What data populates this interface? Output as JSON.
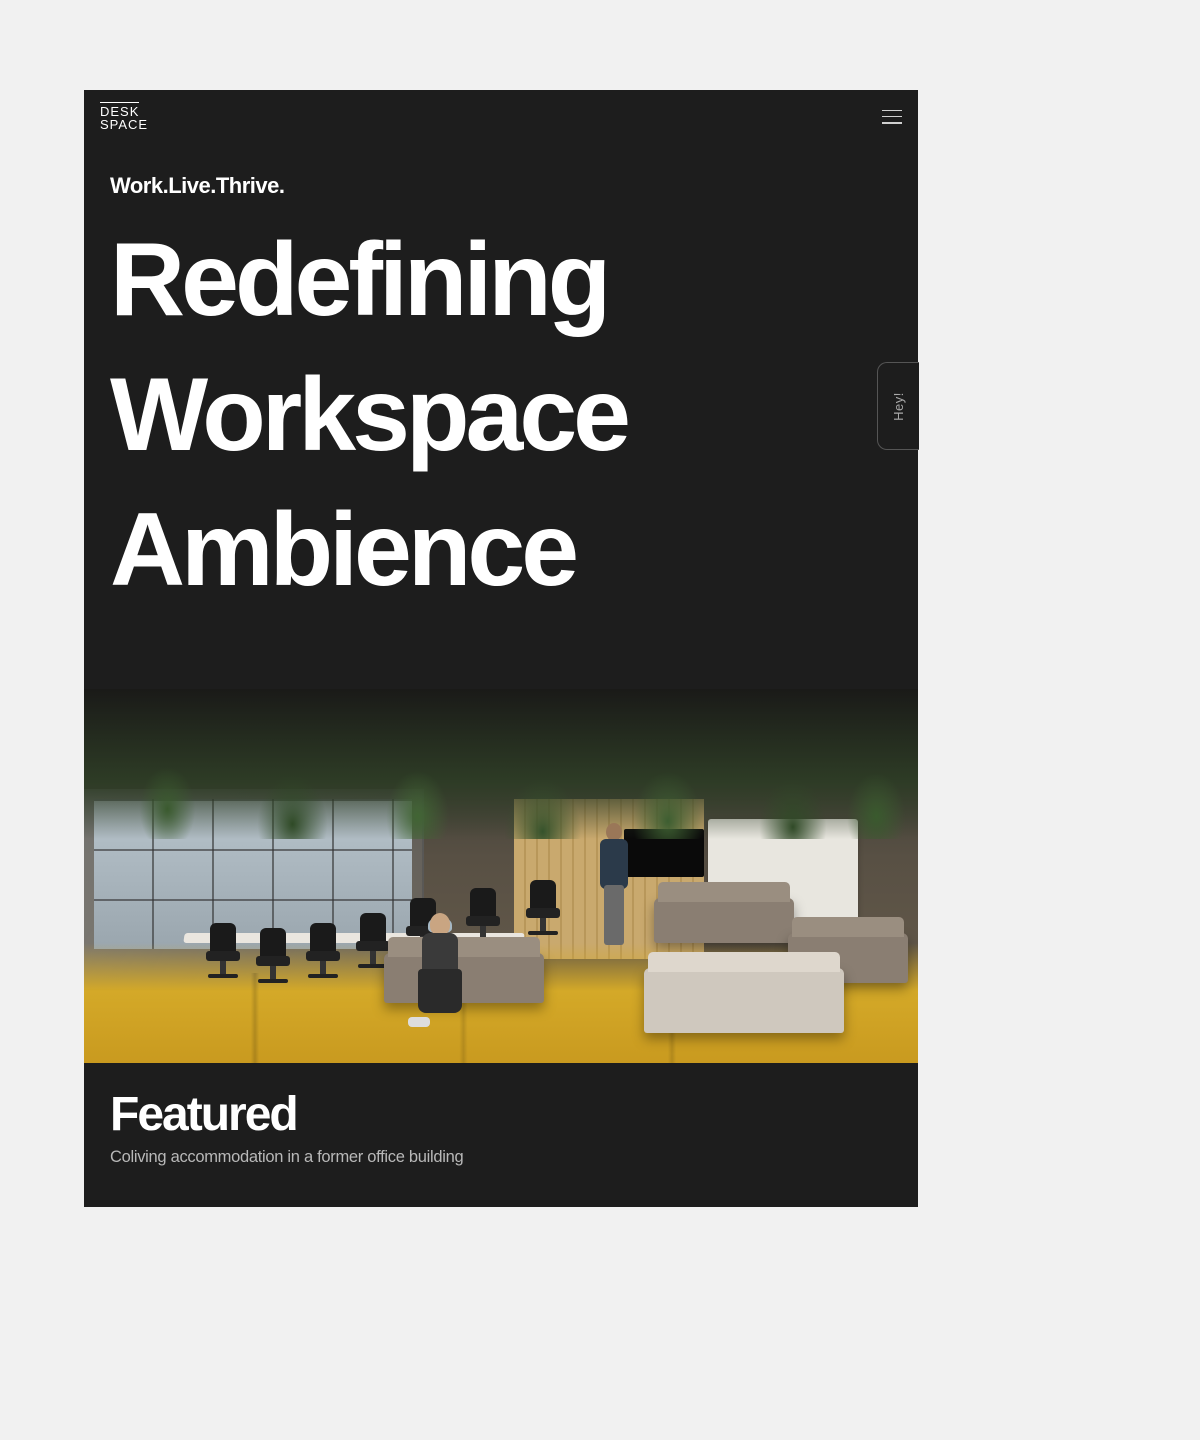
{
  "brand": {
    "line1": "DESK",
    "line2": "SPACE"
  },
  "hero": {
    "tagline": "Work.Live.Thrive.",
    "headline": "Redefining Workspace Ambience"
  },
  "featured": {
    "title": "Featured",
    "subtitle": "Coliving accommodation in a former office building"
  },
  "sideTab": {
    "label": "Hey!"
  },
  "colors": {
    "background": "#1d1d1d",
    "page": "#f1f1f1",
    "text": "#ffffff",
    "muted": "#b8b8b8",
    "accentFloor": "#d4a928"
  }
}
